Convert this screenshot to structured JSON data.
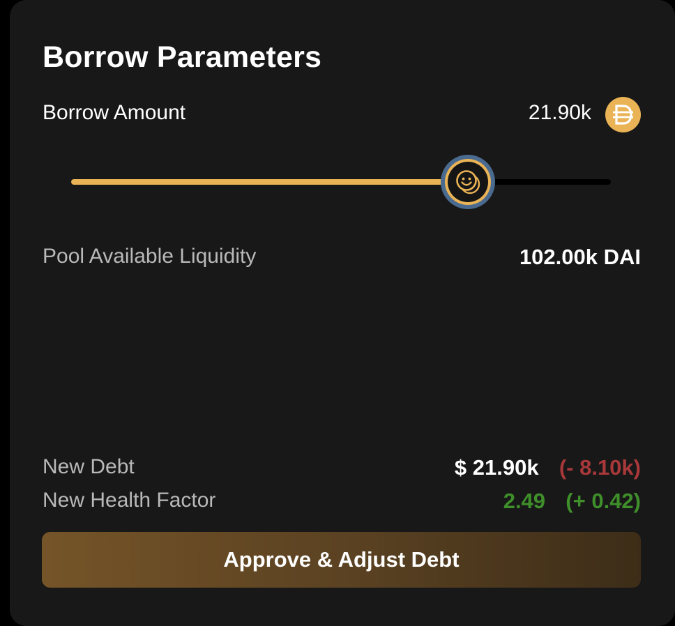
{
  "panel": {
    "title": "Borrow Parameters"
  },
  "borrow": {
    "label": "Borrow Amount",
    "amount": "21.90k",
    "token_icon": "dai-icon",
    "slider_fraction": 0.735,
    "slider_thumb_icon": "smiley-coin-icon"
  },
  "liquidity": {
    "label": "Pool Available Liquidity",
    "value": "102.00k DAI"
  },
  "debt": {
    "label": "New Debt",
    "value": "$ 21.90k",
    "change": "(- 8.10k)"
  },
  "health": {
    "label": "New Health Factor",
    "value": "2.49",
    "change": "(+ 0.42)"
  },
  "action": {
    "button_label": "Approve & Adjust Debt"
  },
  "colors": {
    "accent": "#e9b356",
    "negative": "#a8383a",
    "positive": "#3f8f2b",
    "card_background": "#181818"
  }
}
